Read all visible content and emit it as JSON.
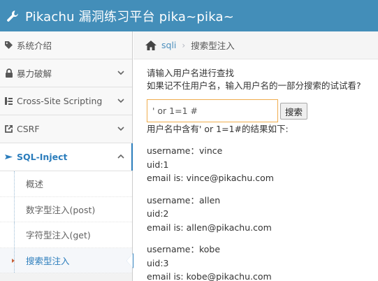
{
  "header": {
    "title": "Pikachu 漏洞练习平台 pika~pika~",
    "bg_color": "#438eb9"
  },
  "sidebar": {
    "items": [
      {
        "label": "系统介绍",
        "icon": "tag-icon"
      },
      {
        "label": "暴力破解",
        "icon": "lock-icon"
      },
      {
        "label": "Cross-Site Scripting",
        "icon": "sitemap-icon"
      },
      {
        "label": "CSRF",
        "icon": "external-link-icon"
      },
      {
        "label": "SQL-Inject",
        "icon": "plane-icon"
      }
    ],
    "subitems": [
      {
        "label": "概述"
      },
      {
        "label": "数字型注入(post)"
      },
      {
        "label": "字符型注入(get)"
      },
      {
        "label": "搜索型注入"
      }
    ],
    "active_color": "#2b7dbc"
  },
  "breadcrumb": {
    "link": "sqli",
    "separator": "›",
    "current": "搜索型注入"
  },
  "main": {
    "prompt_line1": "请输入用户名进行查找",
    "prompt_line2": "如果记不住用户名，输入用户名的一部分搜索的试试看?",
    "search_value": "' or 1=1 #",
    "search_button": "搜索",
    "result_heading": "用户名中含有' or 1=1#的结果如下:",
    "results": [
      {
        "username": "username：vince",
        "uid": "uid:1",
        "email": "email is: vince@pikachu.com"
      },
      {
        "username": "username：allen",
        "uid": "uid:2",
        "email": "email is: allen@pikachu.com"
      },
      {
        "username": "username：kobe",
        "uid": "uid:3",
        "email": "email is: kobe@pikachu.com"
      }
    ]
  }
}
